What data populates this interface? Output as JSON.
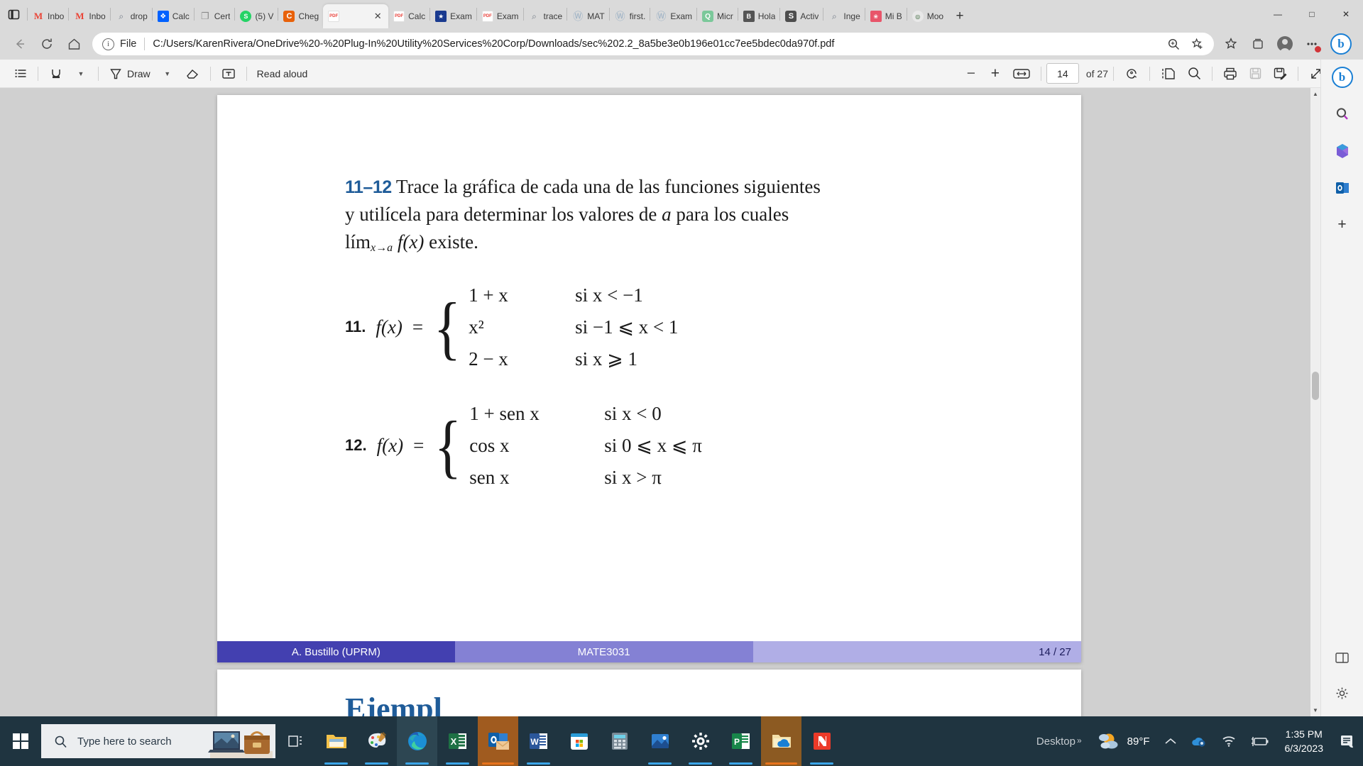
{
  "browser": {
    "tabs": [
      {
        "title": "Inbo",
        "icon": "gmail-icon",
        "active": false
      },
      {
        "title": "Inbo",
        "icon": "gmail-icon",
        "active": false
      },
      {
        "title": "drop",
        "icon": "search-icon",
        "active": false
      },
      {
        "title": "Calc",
        "icon": "dropbox-icon",
        "active": false
      },
      {
        "title": "Cert",
        "icon": "document-icon",
        "active": false
      },
      {
        "title": "(5) V",
        "icon": "whatsapp-icon",
        "active": false
      },
      {
        "title": "Cheg",
        "icon": "chegg-icon",
        "active": false
      },
      {
        "title": "",
        "icon": "pdf-icon",
        "active": true
      },
      {
        "title": "Calc",
        "icon": "pdf-icon",
        "active": false
      },
      {
        "title": "Exam",
        "icon": "shield-icon",
        "active": false
      },
      {
        "title": "Exam",
        "icon": "pdf-icon",
        "active": false
      },
      {
        "title": "trace",
        "icon": "search-icon",
        "active": false
      },
      {
        "title": "MAT",
        "icon": "wordpress-icon",
        "active": false
      },
      {
        "title": "first.",
        "icon": "wordpress-icon",
        "active": false
      },
      {
        "title": "Exam",
        "icon": "wordpress-icon",
        "active": false
      },
      {
        "title": "Micr",
        "icon": "quizlet-icon",
        "active": false
      },
      {
        "title": "Hola",
        "icon": "blackboard-icon",
        "active": false
      },
      {
        "title": "Activ",
        "icon": "sofi-icon",
        "active": false
      },
      {
        "title": "Inge",
        "icon": "search-icon",
        "active": false
      },
      {
        "title": "Mi B",
        "icon": "mibanco-icon",
        "active": false
      },
      {
        "title": "Moo",
        "icon": "moodle-icon",
        "active": false
      }
    ],
    "new_tab_label": "+",
    "window_controls": {
      "minimize": "—",
      "maximize": "□",
      "close": "✕"
    },
    "nav": {
      "back": "←",
      "refresh": "↻",
      "home": "⌂",
      "scheme_label": "File",
      "url": "C:/Users/KarenRivera/OneDrive%20-%20Plug-In%20Utility%20Services%20Corp/Downloads/sec%202.2_8a5be3e0b196e01cc7ee5bdec0da970f.pdf",
      "zoom_icon": "zoom-icon",
      "favorite_icon": "add-favorite-icon",
      "favorites_icon": "favorites-icon",
      "collections_icon": "collections-icon",
      "profile_icon": "profile-icon",
      "settings_more_icon": "more-settings-icon",
      "copilot_label": "b"
    }
  },
  "pdf_toolbar": {
    "toc_label": "table-of-contents",
    "highlight_label": "highlight",
    "draw_label": "Draw",
    "erase_label": "erase",
    "text_label": "add-text",
    "read_aloud_label": "Read aloud",
    "zoom_out": "−",
    "zoom_in": "+",
    "fit_label": "fit-to-width",
    "page_current": "14",
    "page_total_label": "of 27",
    "rotate_label": "rotate",
    "layout_label": "page-layout",
    "search_label": "search",
    "print_label": "print",
    "save_label": "save",
    "save_as_label": "save-as",
    "fullscreen_label": "fullscreen",
    "settings_label": "settings"
  },
  "edge_sidebar": {
    "items": [
      {
        "name": "copilot",
        "glyph": "b"
      },
      {
        "name": "search",
        "glyph": "⌕"
      },
      {
        "name": "office",
        "glyph": "◑"
      },
      {
        "name": "outlook",
        "glyph": "O"
      },
      {
        "name": "add-app",
        "glyph": "+"
      }
    ],
    "bottom": [
      {
        "name": "split-screen",
        "glyph": "◫"
      },
      {
        "name": "customize",
        "glyph": "⚙"
      }
    ]
  },
  "document": {
    "problem_range": "11–12",
    "intro_line1": "Trace la gráfica de cada una de las funciones siguientes",
    "intro_line2_a": "y utilícela para determinar los valores de ",
    "intro_line2_var": "a",
    "intro_line2_b": " para los cuales",
    "intro_line3_lim": "lím",
    "intro_line3_sub": "x→a",
    "intro_line3_fx": "f(x)",
    "intro_line3_rest": " existe.",
    "problem11": {
      "number": "11.",
      "fx": "f(x)",
      "equals": "=",
      "cases": [
        {
          "expr": "1 + x",
          "cond": "si  x < −1"
        },
        {
          "expr": "x²",
          "cond": "si  −1 ⩽ x < 1"
        },
        {
          "expr": "2 − x",
          "cond": "si  x ⩾ 1"
        }
      ]
    },
    "problem12": {
      "number": "12.",
      "fx": "f(x)",
      "equals": "=",
      "cases": [
        {
          "expr": "1 + sen x",
          "cond": "si  x < 0"
        },
        {
          "expr": "cos x",
          "cond": "si  0 ⩽ x ⩽ π"
        },
        {
          "expr": "sen x",
          "cond": "si  x > π"
        }
      ]
    },
    "slide_footer": {
      "author": "A. Bustillo  (UPRM)",
      "course": "MATE3031",
      "pagination": "14 / 27"
    },
    "next_page_teaser": "Ejempl"
  },
  "taskbar": {
    "start_label": "start",
    "search_placeholder": "Type here to search",
    "task_view_label": "task-view",
    "apps": [
      {
        "name": "file-explorer-icon",
        "open": true
      },
      {
        "name": "paint-icon",
        "open": true
      },
      {
        "name": "edge-icon",
        "open": true,
        "active": true
      },
      {
        "name": "excel-icon",
        "open": true
      },
      {
        "name": "outlook-icon",
        "open": true,
        "active": true
      },
      {
        "name": "word-icon",
        "open": true
      },
      {
        "name": "microsoft-store-icon",
        "open": false
      },
      {
        "name": "calculator-icon",
        "open": false
      },
      {
        "name": "photos-icon",
        "open": true
      },
      {
        "name": "settings-icon",
        "open": true
      },
      {
        "name": "publisher-icon",
        "open": true
      },
      {
        "name": "onedrive-folder-icon",
        "open": true,
        "active": true
      },
      {
        "name": "nitro-pdf-icon",
        "open": true
      }
    ],
    "desktop_label": "Desktop",
    "overflow_label": "»",
    "weather": "89°F",
    "tray": [
      "show-hidden-icons",
      "onedrive-icon",
      "network-icon",
      "battery-icon"
    ],
    "time": "1:35 PM",
    "date": "6/3/2023",
    "notification_label": "notifications"
  }
}
